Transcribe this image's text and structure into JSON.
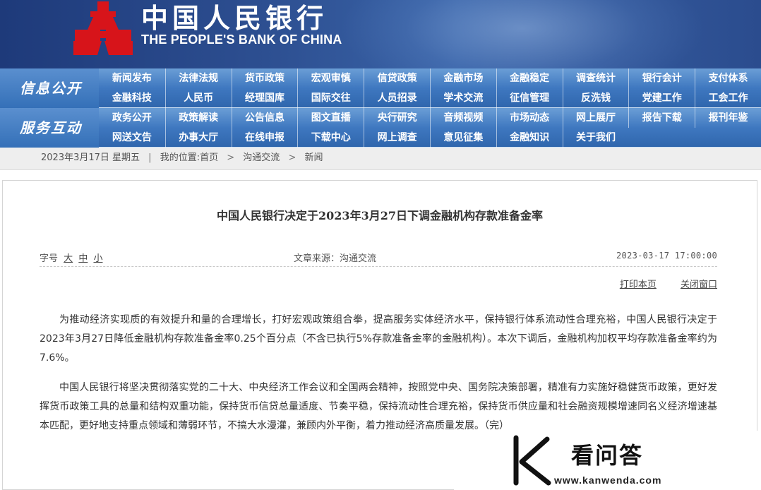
{
  "header": {
    "logo_cn": "中国人民银行",
    "logo_en": "THE PEOPLE'S BANK OF CHINA",
    "logo_color": "#d7141a"
  },
  "nav_info": {
    "label": "信息公开",
    "items": [
      "新闻发布",
      "法律法规",
      "货币政策",
      "宏观审慎",
      "信贷政策",
      "金融市场",
      "金融稳定",
      "调查统计",
      "银行会计",
      "支付体系",
      "金融科技",
      "人民币",
      "经理国库",
      "国际交往",
      "人员招录",
      "学术交流",
      "征信管理",
      "反洗钱",
      "党建工作",
      "工会工作"
    ]
  },
  "nav_service": {
    "label": "服务互动",
    "items": [
      "政务公开",
      "政策解读",
      "公告信息",
      "图文直播",
      "央行研究",
      "音频视频",
      "市场动态",
      "网上展厅",
      "报告下载",
      "报刊年鉴",
      "网送文告",
      "办事大厅",
      "在线申报",
      "下载中心",
      "网上调查",
      "意见征集",
      "金融知识",
      "关于我们"
    ]
  },
  "breadcrumb": {
    "date": "2023年3月17日  星期五",
    "location_label": "我的位置:",
    "home": "首页",
    "section": "沟通交流",
    "current": "新闻",
    "sep": ">"
  },
  "article": {
    "title": "中国人民银行决定于2023年3月27日下调金融机构存款准备金率",
    "fontsize_label": "字号",
    "fontsize_large": "大",
    "fontsize_medium": "中",
    "fontsize_small": "小",
    "source": "文章来源：沟通交流",
    "datetime": "2023-03-17  17:00:00",
    "print_label": "打印本页",
    "close_label": "关闭窗口",
    "paragraphs": [
      "为推动经济实现质的有效提升和量的合理增长，打好宏观政策组合拳，提高服务实体经济水平，保持银行体系流动性合理充裕，中国人民银行决定于2023年3月27日降低金融机构存款准备金率0.25个百分点（不含已执行5%存款准备金率的金融机构）。本次下调后，金融机构加权平均存款准备金率约为7.6%。",
      "中国人民银行将坚决贯彻落实党的二十大、中央经济工作会议和全国两会精神，按照党中央、国务院决策部署，精准有力实施好稳健货币政策，更好发挥货币政策工具的总量和结构双重功能，保持货币信贷总量适度、节奏平稳，保持流动性合理充裕，保持货币供应量和社会融资规模增速同名义经济增速基本匹配，更好地支持重点领域和薄弱环节，不搞大水漫灌，兼顾内外平衡，着力推动经济高质量发展。（完）"
    ]
  },
  "watermark": {
    "text": "看问答",
    "url": "www.kanwenda.com"
  }
}
